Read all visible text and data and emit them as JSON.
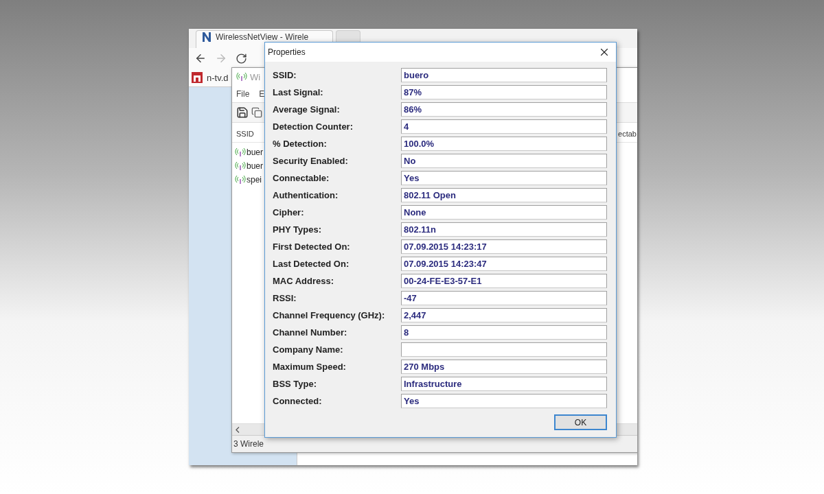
{
  "browser": {
    "tabs": [
      {
        "title": "WirelessNetView - Wirele"
      }
    ],
    "bookmarks": [
      {
        "label": "n-tv.d"
      }
    ]
  },
  "app_window": {
    "title": "Wi",
    "menu": [
      "File",
      "E"
    ],
    "columns": [
      "SSID",
      "ectab"
    ],
    "rows": [
      "buer",
      "buer",
      "spei"
    ],
    "status_bar": "3 Wirele"
  },
  "dialog": {
    "title": "Properties",
    "fields": [
      {
        "label": "SSID:",
        "value": "buero"
      },
      {
        "label": "Last Signal:",
        "value": "87%"
      },
      {
        "label": "Average Signal:",
        "value": "86%"
      },
      {
        "label": "Detection Counter:",
        "value": "4"
      },
      {
        "label": "% Detection:",
        "value": "100.0%"
      },
      {
        "label": "Security Enabled:",
        "value": "No"
      },
      {
        "label": "Connectable:",
        "value": "Yes"
      },
      {
        "label": "Authentication:",
        "value": "802.11 Open"
      },
      {
        "label": "Cipher:",
        "value": "None"
      },
      {
        "label": "PHY Types:",
        "value": "802.11n"
      },
      {
        "label": "First Detected On:",
        "value": "07.09.2015 14:23:17"
      },
      {
        "label": "Last Detected On:",
        "value": "07.09.2015 14:23:47"
      },
      {
        "label": "MAC Address:",
        "value": "00-24-FE-E3-57-E1"
      },
      {
        "label": "RSSI:",
        "value": "-47"
      },
      {
        "label": "Channel Frequency (GHz):",
        "value": "2,447"
      },
      {
        "label": "Channel Number:",
        "value": "8"
      },
      {
        "label": "Company Name:"
      },
      {
        "label": "Maximum Speed:",
        "value": "270 Mbps"
      },
      {
        "label": "BSS Type:",
        "value": "Infrastructure"
      },
      {
        "label": "Connected:",
        "value": "Yes"
      }
    ],
    "buttons": [
      "OK"
    ]
  }
}
